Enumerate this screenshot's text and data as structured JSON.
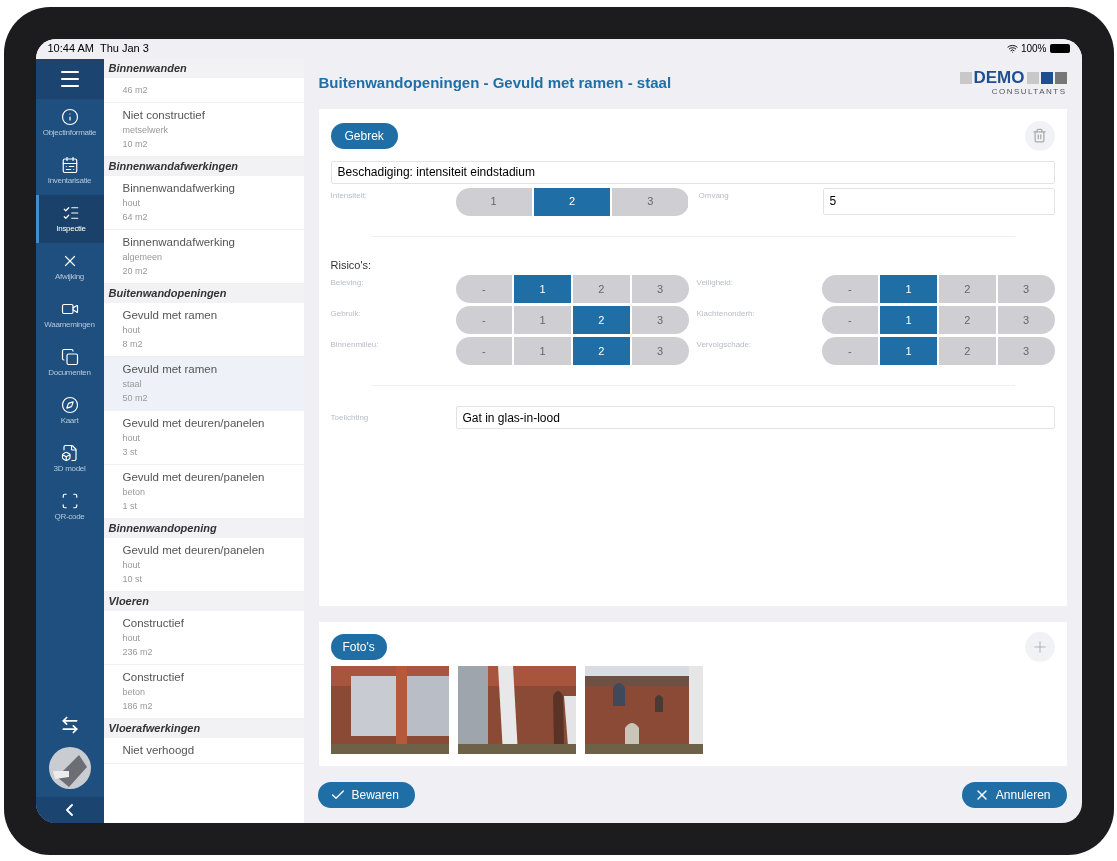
{
  "status_bar": {
    "time": "10:44 AM",
    "date": "Thu Jan 3",
    "battery": "100%"
  },
  "nav": [
    {
      "label": "Objectinformatie",
      "selected": false
    },
    {
      "label": "Inventarisatie",
      "selected": false
    },
    {
      "label": "Inspectie",
      "selected": true
    },
    {
      "label": "Afwijking",
      "selected": false
    },
    {
      "label": "Waarnemingen",
      "selected": false
    },
    {
      "label": "Documenten",
      "selected": false
    },
    {
      "label": "Kaart",
      "selected": false
    },
    {
      "label": "3D model",
      "selected": false
    },
    {
      "label": "QR-code",
      "selected": false
    }
  ],
  "list": [
    {
      "kind": "header",
      "title": "Binnenwanden"
    },
    {
      "kind": "item",
      "lines": [
        "46 m2"
      ],
      "selected": false
    },
    {
      "kind": "item",
      "title": "Niet constructief",
      "lines": [
        "metselwerk",
        "10 m2"
      ],
      "selected": false
    },
    {
      "kind": "header",
      "title": "Binnenwandafwerkingen"
    },
    {
      "kind": "item",
      "title": "Binnenwandafwerking",
      "lines": [
        "hout",
        "64 m2"
      ],
      "selected": false
    },
    {
      "kind": "item",
      "title": "Binnenwandafwerking",
      "lines": [
        "algemeen",
        "20 m2"
      ],
      "selected": false
    },
    {
      "kind": "header",
      "title": "Buitenwandopeningen"
    },
    {
      "kind": "item",
      "title": "Gevuld met ramen",
      "lines": [
        "hout",
        "8 m2"
      ],
      "selected": false
    },
    {
      "kind": "item",
      "title": "Gevuld met ramen",
      "lines": [
        "staal",
        "50 m2"
      ],
      "selected": true
    },
    {
      "kind": "item",
      "title": "Gevuld met deuren/panelen",
      "lines": [
        "hout",
        "3 st"
      ],
      "selected": false
    },
    {
      "kind": "item",
      "title": "Gevuld met deuren/panelen",
      "lines": [
        "beton",
        "1 st"
      ],
      "selected": false
    },
    {
      "kind": "header",
      "title": "Binnenwandopening"
    },
    {
      "kind": "item",
      "title": "Gevuld met deuren/panelen",
      "lines": [
        "hout",
        "10 st"
      ],
      "selected": false
    },
    {
      "kind": "header",
      "title": "Vloeren"
    },
    {
      "kind": "item",
      "title": "Constructief",
      "lines": [
        "hout",
        "236 m2"
      ],
      "selected": false
    },
    {
      "kind": "item",
      "title": "Constructief",
      "lines": [
        "beton",
        "186 m2"
      ],
      "selected": false
    },
    {
      "kind": "header",
      "title": "Vloerafwerkingen"
    },
    {
      "kind": "item",
      "title": "Niet verhoogd",
      "selected": false
    }
  ],
  "title": "Buitenwandopeningen - Gevuld met ramen - staal",
  "logo": {
    "name": "DEMO",
    "sub": "CONSULTANTS"
  },
  "defect": {
    "badge": "Gebrek",
    "description": "Beschadiging: intensiteit eindstadium",
    "intensity": {
      "label": "Intensiteit:",
      "options": [
        {
          "label": "1",
          "selected": false
        },
        {
          "label": "2",
          "selected": true
        },
        {
          "label": "3",
          "selected": false
        }
      ]
    },
    "extent": {
      "label": "Omvang",
      "value": "5"
    },
    "risks_title": "Risico's:",
    "risks": [
      {
        "label": "Beleving:",
        "options": [
          {
            "label": "-",
            "selected": false
          },
          {
            "label": "1",
            "selected": true
          },
          {
            "label": "2",
            "selected": false
          },
          {
            "label": "3",
            "selected": false
          }
        ]
      },
      {
        "label": "Veiligheid:",
        "options": [
          {
            "label": "-",
            "selected": false
          },
          {
            "label": "1",
            "selected": true
          },
          {
            "label": "2",
            "selected": false
          },
          {
            "label": "3",
            "selected": false
          }
        ]
      },
      {
        "label": "Gebruik:",
        "options": [
          {
            "label": "-",
            "selected": false
          },
          {
            "label": "1",
            "selected": false
          },
          {
            "label": "2",
            "selected": true
          },
          {
            "label": "3",
            "selected": false
          }
        ]
      },
      {
        "label": "Klachtenonderh:",
        "options": [
          {
            "label": "-",
            "selected": false
          },
          {
            "label": "1",
            "selected": true
          },
          {
            "label": "2",
            "selected": false
          },
          {
            "label": "3",
            "selected": false
          }
        ]
      },
      {
        "label": "Binnenmilieu:",
        "options": [
          {
            "label": "-",
            "selected": false
          },
          {
            "label": "1",
            "selected": false
          },
          {
            "label": "2",
            "selected": true
          },
          {
            "label": "3",
            "selected": false
          }
        ]
      },
      {
        "label": "Vervolgschade:",
        "options": [
          {
            "label": "-",
            "selected": false
          },
          {
            "label": "1",
            "selected": true
          },
          {
            "label": "2",
            "selected": false
          },
          {
            "label": "3",
            "selected": false
          }
        ]
      }
    ],
    "note": {
      "label": "Toelichting",
      "value": "Gat in glas-in-lood"
    }
  },
  "photos": {
    "badge": "Foto's"
  },
  "actions": {
    "save": "Bewaren",
    "cancel": "Annuleren"
  }
}
